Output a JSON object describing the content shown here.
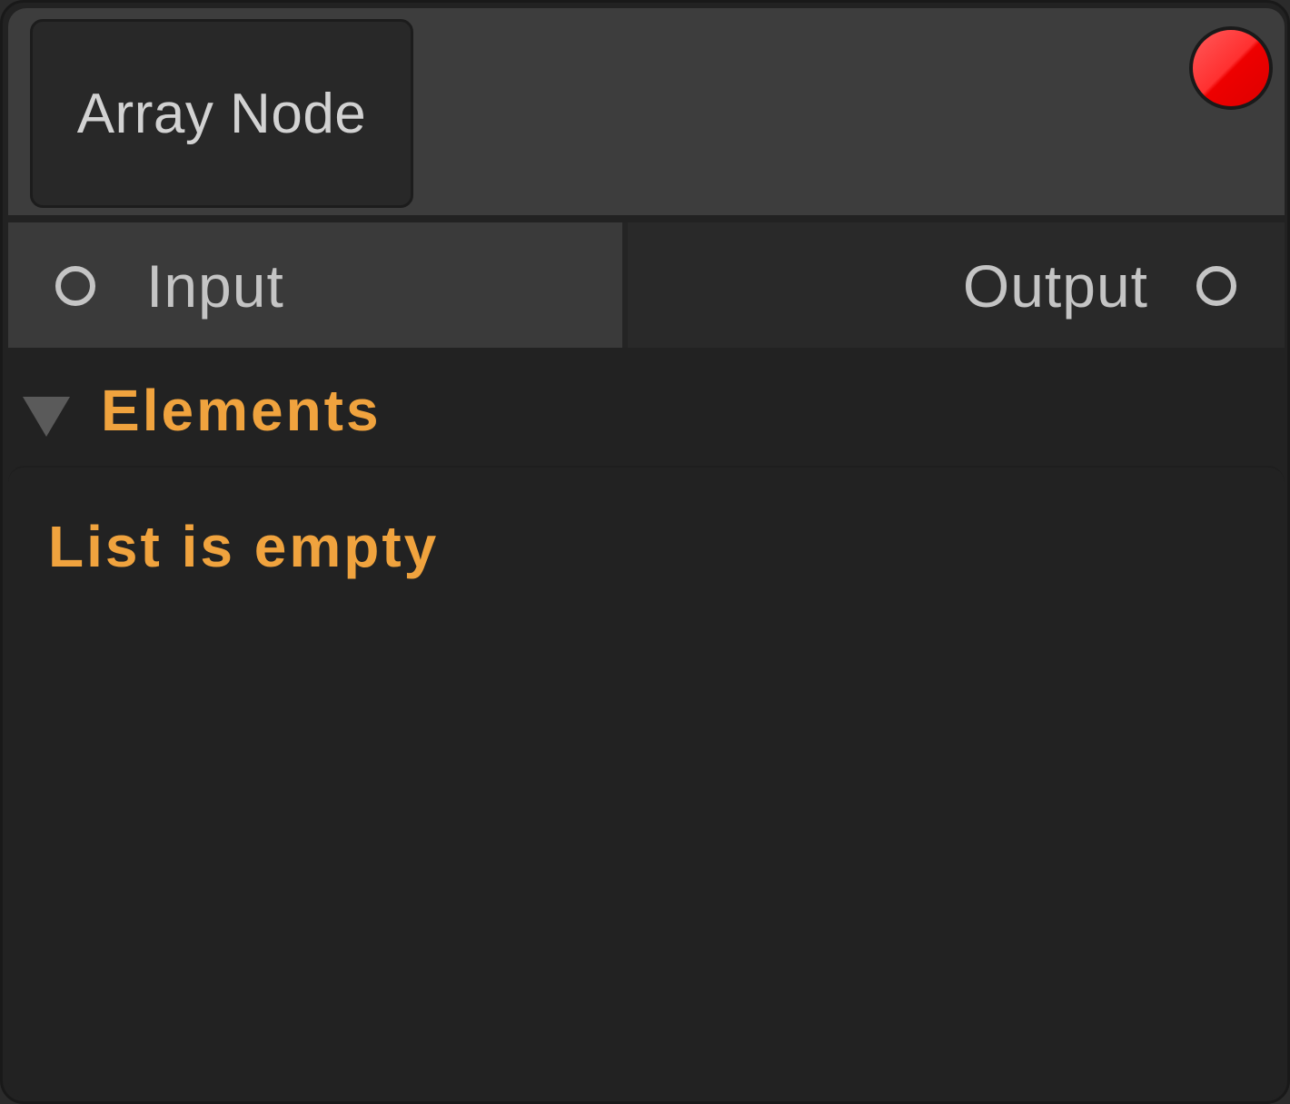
{
  "node": {
    "title": "Array Node",
    "status_color": "#ff1a1a"
  },
  "ports": {
    "input_label": "Input",
    "output_label": "Output"
  },
  "elements": {
    "label": "Elements",
    "expanded": true,
    "empty_message": "List is empty"
  },
  "colors": {
    "accent": "#f0a33e",
    "header_bg": "#3d3d3d",
    "body_bg": "#222222"
  }
}
